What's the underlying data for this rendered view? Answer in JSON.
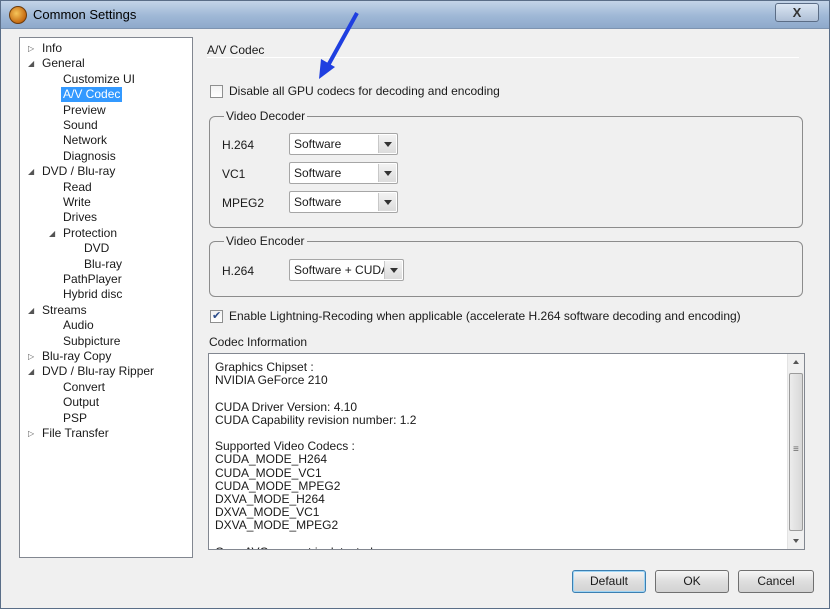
{
  "window": {
    "title": "Common Settings",
    "close_label": "X"
  },
  "tree": {
    "items": [
      {
        "label": "Info",
        "level": 0,
        "expander": "collapsed"
      },
      {
        "label": "General",
        "level": 0,
        "expander": "expanded"
      },
      {
        "label": "Customize UI",
        "level": 1,
        "expander": ""
      },
      {
        "label": "A/V Codec",
        "level": 1,
        "expander": "",
        "selected": true
      },
      {
        "label": "Preview",
        "level": 1,
        "expander": ""
      },
      {
        "label": "Sound",
        "level": 1,
        "expander": ""
      },
      {
        "label": "Network",
        "level": 1,
        "expander": ""
      },
      {
        "label": "Diagnosis",
        "level": 1,
        "expander": ""
      },
      {
        "label": "DVD / Blu-ray",
        "level": 0,
        "expander": "expanded"
      },
      {
        "label": "Read",
        "level": 1,
        "expander": ""
      },
      {
        "label": "Write",
        "level": 1,
        "expander": ""
      },
      {
        "label": "Drives",
        "level": 1,
        "expander": ""
      },
      {
        "label": "Protection",
        "level": 1,
        "expander": "expanded"
      },
      {
        "label": "DVD",
        "level": 2,
        "expander": ""
      },
      {
        "label": "Blu-ray",
        "level": 2,
        "expander": ""
      },
      {
        "label": "PathPlayer",
        "level": 1,
        "expander": ""
      },
      {
        "label": "Hybrid disc",
        "level": 1,
        "expander": ""
      },
      {
        "label": "Streams",
        "level": 0,
        "expander": "expanded"
      },
      {
        "label": "Audio",
        "level": 1,
        "expander": ""
      },
      {
        "label": "Subpicture",
        "level": 1,
        "expander": ""
      },
      {
        "label": "Blu-ray Copy",
        "level": 0,
        "expander": "collapsed"
      },
      {
        "label": "DVD / Blu-ray Ripper",
        "level": 0,
        "expander": "expanded"
      },
      {
        "label": "Convert",
        "level": 1,
        "expander": ""
      },
      {
        "label": "Output",
        "level": 1,
        "expander": ""
      },
      {
        "label": "PSP",
        "level": 1,
        "expander": ""
      },
      {
        "label": "File Transfer",
        "level": 0,
        "expander": "collapsed"
      }
    ]
  },
  "main": {
    "section_title": "A/V Codec",
    "disable_gpu": {
      "label": "Disable all GPU codecs for decoding and encoding",
      "checked": false
    },
    "decoder": {
      "title": "Video Decoder",
      "rows": [
        {
          "label": "H.264",
          "value": "Software"
        },
        {
          "label": "VC1",
          "value": "Software"
        },
        {
          "label": "MPEG2",
          "value": "Software"
        }
      ]
    },
    "encoder": {
      "title": "Video Encoder",
      "rows": [
        {
          "label": "H.264",
          "value": "Software + CUDA"
        }
      ]
    },
    "lightning": {
      "label": "Enable Lightning-Recoding when applicable (accelerate H.264 software decoding and encoding)",
      "checked": true
    },
    "codec_info": {
      "title": "Codec Information",
      "lines": [
        "Graphics Chipset :",
        "NVIDIA GeForce 210",
        "",
        "CUDA Driver Version: 4.10",
        "CUDA Capability revision number: 1.2",
        "",
        "Supported Video Codecs :",
        "CUDA_MODE_H264",
        "CUDA_MODE_VC1",
        "CUDA_MODE_MPEG2",
        "DXVA_MODE_H264",
        "DXVA_MODE_VC1",
        "DXVA_MODE_MPEG2",
        "",
        "OpenAVC support is detected."
      ]
    }
  },
  "buttons": {
    "default": "Default",
    "ok": "OK",
    "cancel": "Cancel"
  },
  "colors": {
    "selection": "#3399ff",
    "annotation_arrow": "#1f3fe0"
  }
}
